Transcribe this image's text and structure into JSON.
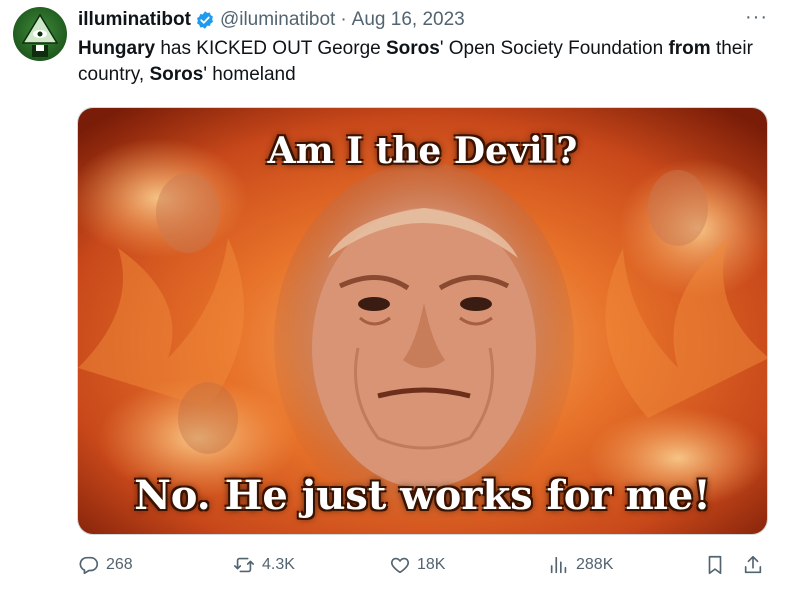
{
  "tweet": {
    "author_name": "illuminatibot",
    "handle": "@iluminatibot",
    "separator": "·",
    "date": "Aug 16, 2023",
    "more": "···",
    "text": {
      "p1_bold": "Hungary",
      "p2": " has KICKED OUT George ",
      "p3_bold": "Soros",
      "p4": "' Open Society Foundation ",
      "p5_bold": "from",
      "p6": " their country, ",
      "p7_bold": "Soros",
      "p8": "' homeland"
    },
    "media": {
      "top_caption": "Am I the Devil?",
      "bottom_caption": "No. He just works for me!"
    },
    "actions": {
      "replies": "268",
      "reposts": "4.3K",
      "likes": "18K",
      "views": "288K"
    }
  },
  "colors": {
    "verified": "#1d9bf0",
    "muted": "#536471",
    "text": "#0f1419"
  },
  "icons": [
    "verified-badge-icon",
    "more-icon",
    "reply-icon",
    "repost-icon",
    "like-icon",
    "views-icon",
    "bookmark-icon",
    "share-icon"
  ]
}
